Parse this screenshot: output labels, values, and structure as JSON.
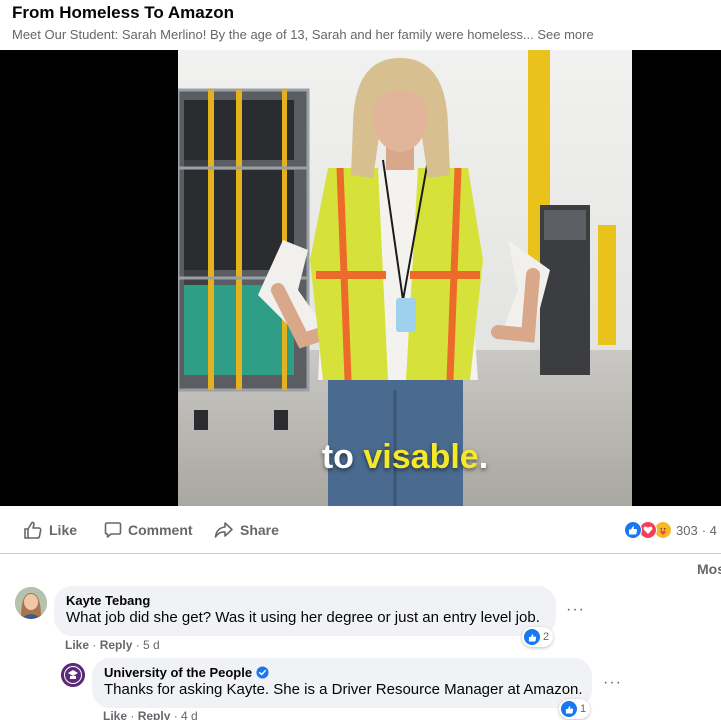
{
  "post": {
    "title": "From Homeless To Amazon",
    "description": "Meet Our Student: Sarah Merlino! By the age of 13, Sarah and her family were homeless...",
    "see_more": "See more"
  },
  "video": {
    "caption_prefix": "to ",
    "caption_highlight": "visable",
    "caption_suffix": ".",
    "caption_highlight_color": "#f5e82a"
  },
  "actions": {
    "like_label": "Like",
    "comment_label": "Comment",
    "share_label": "Share"
  },
  "reactions": {
    "count": "303",
    "trailing": "· 4",
    "icons": [
      "like-icon",
      "love-icon",
      "care-icon"
    ]
  },
  "sort_label": "Mos",
  "comments": [
    {
      "author": "Kayte Tebang",
      "text": "What job did she get? Was it using her degree or just an entry level job.",
      "like_label": "Like",
      "reply_label": "Reply",
      "time": "5 d",
      "reaction_count": "2"
    },
    {
      "author": "University of the People",
      "verified": true,
      "text": "Thanks for asking Kayte. She is a Driver Resource Manager at Amazon.",
      "like_label": "Like",
      "reply_label": "Reply",
      "time": "4 d",
      "reaction_count": "1"
    }
  ],
  "colors": {
    "brand_blue": "#1877f2",
    "secondary_text": "#65676b",
    "bubble_bg": "#f0f2f5"
  }
}
